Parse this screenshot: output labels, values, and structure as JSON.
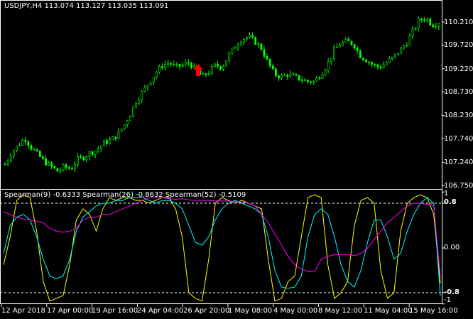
{
  "main_chart": {
    "title": "USDJPY,H4  113.074 113.127 113.035 113.091",
    "candle_color": "#00ff00",
    "arrow_color": "#ff0000",
    "y_ticks": [
      "110.210",
      "109.720",
      "109.220",
      "108.730",
      "108.230",
      "107.740",
      "107.240",
      "106.750"
    ]
  },
  "indicator": {
    "title": "Spearman(9) -0.6333  Spearman(26) -0.8632  Spearman(52) -0.5109",
    "levels": [
      "1",
      "0.8",
      "0.00",
      "-0.8",
      "-1"
    ],
    "line_colors": {
      "spearman9": "#ffff00",
      "spearman26": "#00ffff",
      "spearman52": "#ff00ff"
    }
  },
  "x_axis": [
    "12 Apr 2018",
    "17 Apr 00:00",
    "19 Apr 16:00",
    "24 Apr 04:00",
    "26 Apr 20:00",
    "1 May 08:00",
    "4 May 00:00",
    "8 May 12:00",
    "11 May 04:00",
    "15 May 16:00"
  ],
  "chart_data": [
    {
      "type": "candlestick",
      "title": "USDJPY,H4",
      "y_ticks": [
        110.21,
        109.72,
        109.22,
        108.73,
        108.23,
        107.74,
        107.24,
        106.75
      ],
      "last": {
        "open": 113.074,
        "high": 113.127,
        "low": 113.035,
        "close": 113.091
      },
      "series": [
        {
          "name": "USDJPY,H4",
          "close_path": [
            [
              0,
              107.2
            ],
            [
              3,
              107.45
            ],
            [
              6,
              107.6
            ],
            [
              9,
              107.75
            ],
            [
              12,
              107.55
            ],
            [
              15,
              107.4
            ],
            [
              18,
              107.25
            ],
            [
              21,
              107.15
            ],
            [
              24,
              107.05
            ],
            [
              27,
              107.15
            ],
            [
              30,
              107.1
            ],
            [
              33,
              107.3
            ],
            [
              36,
              107.35
            ],
            [
              39,
              107.45
            ],
            [
              42,
              107.5
            ],
            [
              45,
              107.65
            ],
            [
              48,
              107.7
            ],
            [
              51,
              107.8
            ],
            [
              54,
              108.0
            ],
            [
              57,
              108.25
            ],
            [
              60,
              108.55
            ],
            [
              63,
              108.75
            ],
            [
              66,
              108.95
            ],
            [
              69,
              109.15
            ],
            [
              72,
              109.3
            ],
            [
              75,
              109.35
            ],
            [
              78,
              109.25
            ],
            [
              81,
              109.3
            ],
            [
              84,
              109.35
            ],
            [
              87,
              109.2
            ],
            [
              90,
              109.05
            ],
            [
              93,
              109.15
            ],
            [
              96,
              109.3
            ],
            [
              99,
              109.25
            ],
            [
              102,
              109.5
            ],
            [
              105,
              109.7
            ],
            [
              108,
              109.85
            ],
            [
              111,
              109.9
            ],
            [
              114,
              109.8
            ],
            [
              117,
              109.65
            ],
            [
              120,
              109.35
            ],
            [
              123,
              109.1
            ],
            [
              126,
              109.05
            ],
            [
              129,
              109.1
            ],
            [
              132,
              109.05
            ],
            [
              135,
              109.0
            ],
            [
              138,
              108.95
            ],
            [
              141,
              108.95
            ],
            [
              144,
              109.1
            ],
            [
              147,
              109.3
            ],
            [
              150,
              109.6
            ],
            [
              153,
              109.75
            ],
            [
              156,
              109.8
            ],
            [
              159,
              109.75
            ],
            [
              162,
              109.5
            ],
            [
              165,
              109.4
            ],
            [
              168,
              109.3
            ],
            [
              171,
              109.25
            ],
            [
              174,
              109.35
            ],
            [
              177,
              109.45
            ],
            [
              180,
              109.6
            ],
            [
              183,
              109.75
            ],
            [
              186,
              110.0
            ],
            [
              189,
              110.25
            ],
            [
              192,
              110.3
            ],
            [
              195,
              110.15
            ],
            [
              198,
              110.2
            ]
          ]
        }
      ]
    },
    {
      "type": "line",
      "title": "Spearman",
      "ylim": [
        -1,
        1
      ],
      "y_ticks": [
        1,
        0.8,
        0,
        -0.8,
        -1
      ],
      "series": [
        {
          "name": "Spearman(9)",
          "last": -0.6333,
          "x": [
            0,
            3,
            6,
            9,
            12,
            15,
            18,
            21,
            24,
            27,
            30,
            33,
            36,
            39,
            42,
            45,
            48,
            51,
            54,
            57,
            60,
            63,
            66,
            69,
            72,
            75,
            78,
            81,
            84,
            87,
            90,
            93,
            96,
            99,
            102,
            105,
            108,
            111,
            114,
            117,
            120,
            123,
            126,
            129,
            132,
            135,
            138,
            141,
            144,
            147,
            150,
            153,
            156,
            159,
            162,
            165,
            168,
            171,
            174,
            177,
            180,
            183,
            186,
            189,
            192,
            195,
            198
          ],
          "values": [
            -0.3,
            0.2,
            0.85,
            0.95,
            0.9,
            0.3,
            -0.6,
            -0.95,
            -0.9,
            -0.85,
            -0.3,
            0.5,
            0.7,
            0.6,
            0.3,
            0.7,
            0.9,
            0.85,
            0.9,
            0.9,
            0.85,
            0.85,
            0.8,
            0.85,
            0.9,
            0.9,
            0.7,
            0.2,
            -0.8,
            -0.9,
            -0.95,
            -0.2,
            0.8,
            0.9,
            0.85,
            0.8,
            0.85,
            0.8,
            0.75,
            0.7,
            -0.2,
            -0.95,
            -0.9,
            -0.6,
            -0.5,
            0.2,
            0.9,
            0.95,
            0.9,
            -0.3,
            -0.9,
            -0.8,
            -0.6,
            0.4,
            0.85,
            0.9,
            0.8,
            -0.4,
            -0.9,
            -0.8,
            0.3,
            0.8,
            0.9,
            0.95,
            0.9,
            0.6,
            -0.63
          ]
        },
        {
          "name": "Spearman(26)",
          "last": -0.8632,
          "x": [
            0,
            3,
            6,
            9,
            12,
            15,
            18,
            21,
            24,
            27,
            30,
            33,
            36,
            39,
            42,
            45,
            48,
            51,
            54,
            57,
            60,
            63,
            66,
            69,
            72,
            75,
            78,
            81,
            84,
            87,
            90,
            93,
            96,
            99,
            102,
            105,
            108,
            111,
            114,
            117,
            120,
            123,
            126,
            129,
            132,
            135,
            138,
            141,
            144,
            147,
            150,
            153,
            156,
            159,
            162,
            165,
            168,
            171,
            174,
            177,
            180,
            183,
            186,
            189,
            192,
            195,
            198
          ],
          "values": [
            -0.1,
            0.4,
            0.55,
            0.6,
            0.5,
            0.2,
            -0.2,
            -0.5,
            -0.55,
            -0.5,
            -0.2,
            0.3,
            0.55,
            0.65,
            0.75,
            0.8,
            0.8,
            0.85,
            0.85,
            0.9,
            0.9,
            0.9,
            0.85,
            0.8,
            0.85,
            0.85,
            0.8,
            0.7,
            0.4,
            0.1,
            0.05,
            0.2,
            0.5,
            0.7,
            0.8,
            0.85,
            0.8,
            0.75,
            0.7,
            0.6,
            0.2,
            -0.4,
            -0.7,
            -0.72,
            -0.7,
            -0.5,
            0.2,
            0.6,
            0.7,
            0.6,
            0.2,
            -0.3,
            -0.6,
            -0.7,
            -0.4,
            0.1,
            0.5,
            0.5,
            0.2,
            -0.2,
            -0.1,
            0.3,
            0.6,
            0.8,
            0.9,
            0.8,
            -0.86
          ]
        },
        {
          "name": "Spearman(52)",
          "last": -0.5109,
          "x": [
            0,
            3,
            6,
            9,
            12,
            15,
            18,
            21,
            24,
            27,
            30,
            33,
            36,
            39,
            42,
            45,
            48,
            51,
            54,
            57,
            60,
            63,
            66,
            69,
            72,
            75,
            78,
            81,
            84,
            87,
            90,
            93,
            96,
            99,
            102,
            105,
            108,
            111,
            114,
            117,
            120,
            123,
            126,
            129,
            132,
            135,
            138,
            141,
            144,
            147,
            150,
            153,
            156,
            159,
            162,
            165,
            168,
            171,
            174,
            177,
            180,
            183,
            186,
            189,
            192,
            195,
            198
          ],
          "values": [
            0.65,
            0.6,
            0.55,
            0.52,
            0.5,
            0.48,
            0.45,
            0.35,
            0.3,
            0.28,
            0.3,
            0.35,
            0.5,
            0.55,
            0.55,
            0.6,
            0.6,
            0.65,
            0.7,
            0.75,
            0.8,
            0.85,
            0.9,
            0.9,
            0.9,
            0.88,
            0.87,
            0.88,
            0.86,
            0.85,
            0.85,
            0.85,
            0.84,
            0.84,
            0.84,
            0.83,
            0.82,
            0.8,
            0.75,
            0.6,
            0.45,
            0.25,
            0.05,
            -0.15,
            -0.3,
            -0.38,
            -0.42,
            -0.42,
            -0.2,
            -0.15,
            -0.12,
            -0.12,
            -0.12,
            -0.14,
            -0.1,
            0.0,
            0.15,
            0.3,
            0.45,
            0.55,
            0.65,
            0.75,
            0.8,
            0.8,
            0.78,
            0.75,
            -0.51
          ]
        }
      ]
    }
  ]
}
